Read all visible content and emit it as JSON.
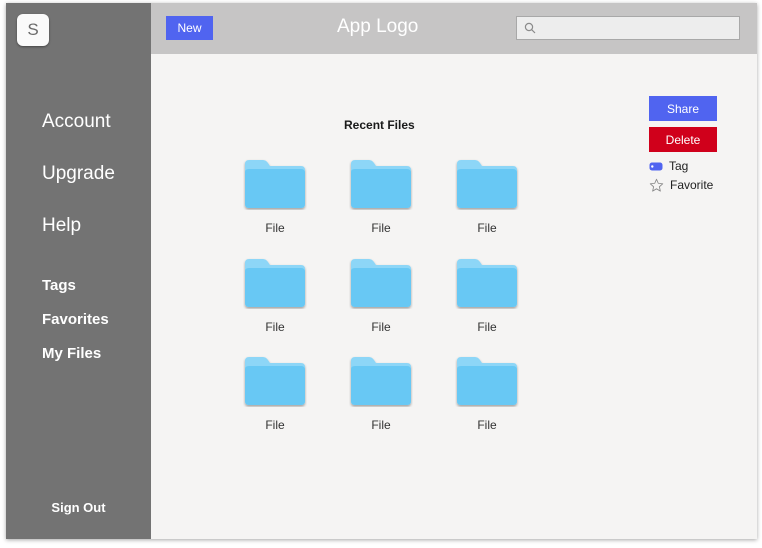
{
  "sidebar": {
    "badge": "S",
    "primary": [
      {
        "label": "Account"
      },
      {
        "label": "Upgrade"
      },
      {
        "label": "Help"
      }
    ],
    "secondary": [
      {
        "label": "Tags"
      },
      {
        "label": "Favorites"
      },
      {
        "label": "My Files"
      }
    ],
    "sign_out": "Sign Out"
  },
  "header": {
    "new_label": "New",
    "logo": "App Logo",
    "search_placeholder": "",
    "search_icon": "search-icon"
  },
  "main": {
    "title": "Recent Files",
    "files": [
      {
        "label": "File"
      },
      {
        "label": "File"
      },
      {
        "label": "File"
      },
      {
        "label": "File"
      },
      {
        "label": "File"
      },
      {
        "label": "File"
      },
      {
        "label": "File"
      },
      {
        "label": "File"
      },
      {
        "label": "File"
      }
    ],
    "folder_icon": "folder-icon"
  },
  "actions": {
    "share": "Share",
    "delete": "Delete",
    "tag": "Tag",
    "favorite": "Favorite",
    "tag_icon": "tag-icon",
    "favorite_icon": "star-icon"
  },
  "colors": {
    "sidebar": "#737373",
    "header": "#c6c5c5",
    "primary_button": "#5064f0",
    "danger_button": "#d0001b",
    "folder": "#68c8f4"
  }
}
